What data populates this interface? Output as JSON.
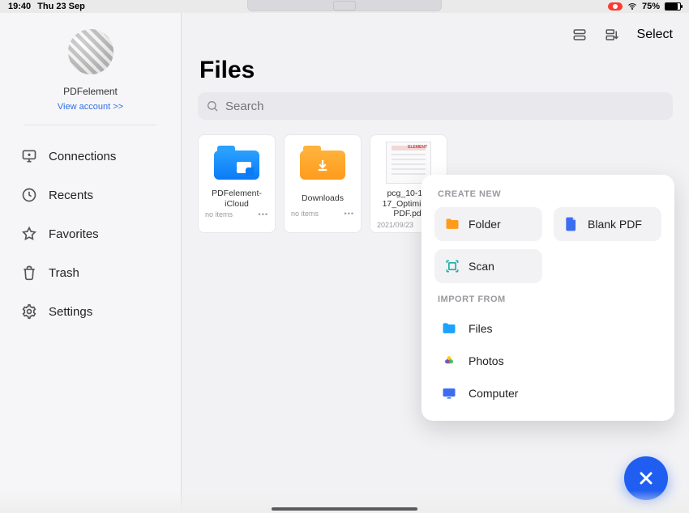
{
  "status": {
    "time": "19:40",
    "date": "Thu 23 Sep",
    "battery": "75%"
  },
  "sidebar": {
    "app_name": "PDFelement",
    "view_account": "View account >>",
    "items": [
      {
        "label": "Connections",
        "icon": "monitor-icon"
      },
      {
        "label": "Recents",
        "icon": "clock-icon"
      },
      {
        "label": "Favorites",
        "icon": "star-icon"
      },
      {
        "label": "Trash",
        "icon": "trash-icon"
      },
      {
        "label": "Settings",
        "icon": "gear-icon"
      }
    ]
  },
  "toolbar": {
    "select": "Select"
  },
  "main": {
    "title": "Files",
    "search_placeholder": "Search"
  },
  "tiles": [
    {
      "title": "PDFelement-iCloud",
      "meta": "no items",
      "icon": "folder-cloud-icon"
    },
    {
      "title": "Downloads",
      "meta": "no items",
      "icon": "folder-download-icon"
    },
    {
      "title": "pcg_10-12-17_Optimized PDF.pdf",
      "meta": "2021/09/23",
      "icon": "pdf-thumbnail-icon"
    }
  ],
  "popover": {
    "create_title": "CREATE NEW",
    "create": [
      {
        "label": "Folder",
        "icon": "folder-orange-icon"
      },
      {
        "label": "Blank PDF",
        "icon": "page-icon"
      },
      {
        "label": "Scan",
        "icon": "scan-icon"
      }
    ],
    "import_title": "IMPORT FROM",
    "import": [
      {
        "label": "Files",
        "icon": "folder-blue-icon"
      },
      {
        "label": "Photos",
        "icon": "photos-icon"
      },
      {
        "label": "Computer",
        "icon": "computer-icon"
      }
    ]
  },
  "colors": {
    "accent_blue": "#1f5ef0",
    "folder_blue": "#1ea1ff",
    "folder_orange": "#ff9b1c",
    "teal": "#17b0a8"
  }
}
